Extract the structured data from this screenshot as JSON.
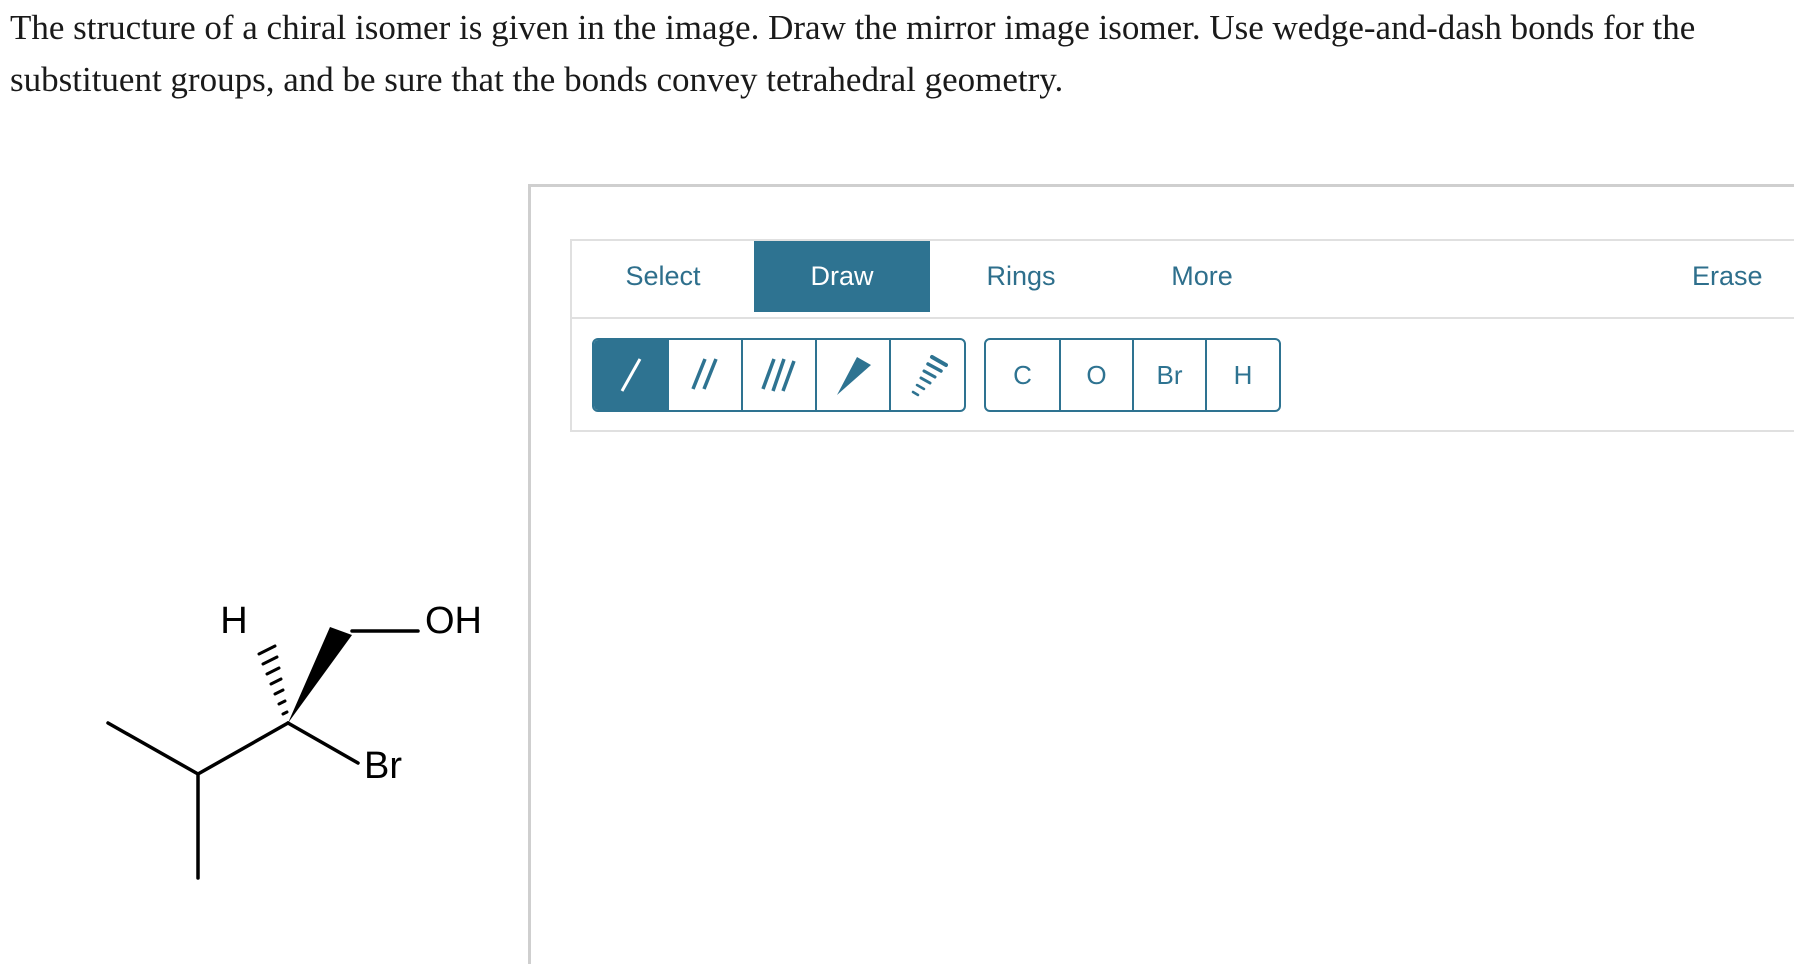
{
  "question": "The structure of a chiral isomer is given in the image. Draw the mirror image isomer. Use wedge-and-dash bonds for the substituent groups, and be sure that the bonds convey tetrahedral geometry.",
  "molecule": {
    "labels": {
      "h": "H",
      "oh": "OH",
      "br": "Br"
    }
  },
  "toolbar": {
    "tabs": {
      "select": "Select",
      "draw": "Draw",
      "rings": "Rings",
      "more": "More",
      "erase": "Erase"
    },
    "active_tab": "Draw",
    "bond_tools": [
      "single-bond-icon",
      "double-bond-icon",
      "triple-bond-icon",
      "wedge-bond-icon",
      "dash-bond-icon"
    ],
    "atoms": {
      "c": "C",
      "o": "O",
      "br": "Br",
      "h": "H"
    }
  },
  "colors": {
    "accent": "#2e7391",
    "text_accent": "#2e6f8c",
    "border": "#cfcfcf"
  }
}
